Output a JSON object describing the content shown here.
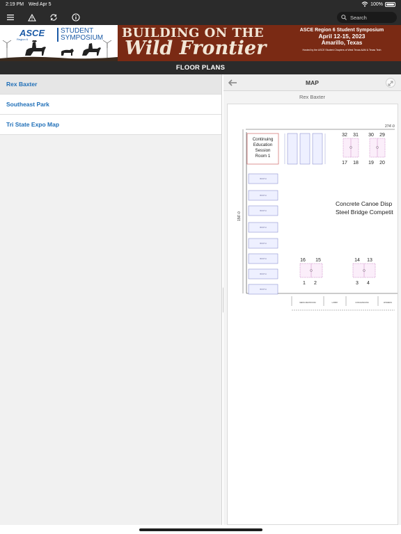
{
  "status": {
    "time": "2:19 PM",
    "date": "Wed Apr 5",
    "battery": "100%"
  },
  "toolbar": {
    "search_placeholder": "Search"
  },
  "banner": {
    "asce": "ASCE",
    "asce_sub": "Region 6",
    "student": "STUDENT",
    "symposium": "SYMPOSIUM",
    "headline1": "BUILDING ON THE",
    "headline2": "Wild Frontier",
    "sym_line1": "ASCE Region 6 Student Symposium",
    "sym_line2": "April 12-15, 2023",
    "sym_line3": "Amarillo, Texas",
    "sym_line4": "Hosted by the ASCE Student Chapters of West Texas A&M & Texas Tech"
  },
  "section_header": "FLOOR PLANS",
  "sidebar": {
    "items": [
      {
        "label": "Rex Baxter",
        "selected": true
      },
      {
        "label": "Southeast Park",
        "selected": false
      },
      {
        "label": "Tri State Expo Map",
        "selected": false
      }
    ]
  },
  "map": {
    "title": "MAP",
    "name": "Rex Baxter",
    "room_label": [
      "Continuing",
      "Education",
      "Session",
      "Room 1"
    ],
    "dim_top": "274'-0",
    "dim_side": "156'-0",
    "event_line1": "Concrete Canoe Disp",
    "event_line2": "Steel Bridge Competit",
    "booth_numbers": {
      "top_group_a": [
        "32",
        "31",
        "17",
        "18"
      ],
      "top_group_b": [
        "30",
        "29",
        "19",
        "20"
      ],
      "bottom_group_a": [
        "16",
        "15",
        "1",
        "2"
      ],
      "bottom_group_b": [
        "14",
        "13",
        "3",
        "4"
      ]
    },
    "booth_label": "BOOTH",
    "footer_labels": [
      "MENS RESTROOM",
      "LOBBY",
      "CONCESSIONS",
      "WOMENS"
    ]
  }
}
